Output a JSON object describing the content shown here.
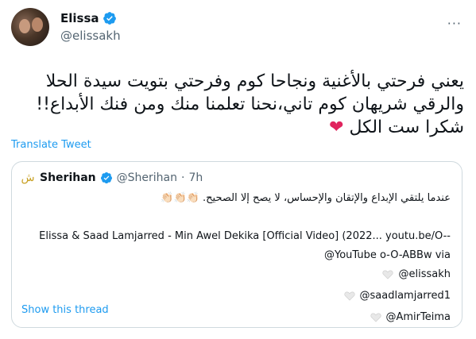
{
  "author": {
    "name": "Elissa",
    "handle": "@elissakh",
    "verified": true
  },
  "more_label": "···",
  "tweet": {
    "line1": "يعني فرحتي بالأغنية ونجاحا كوم وفرحتي بتويت سيدة الحلا",
    "line2": "والرقي شريهان كوم تاني،نحنا تعلمنا منك ومن فنك الأبداع!!",
    "line3": "شكرا ست الكل",
    "heart": "❤"
  },
  "translate_label": "Translate Tweet",
  "quote": {
    "avatar_glyph": "ش",
    "name": "Sherihan",
    "handle": "@Sherihan",
    "separator": "·",
    "time": "7h",
    "line1": "عندما يلتقي الإبداع والإتقان والإحساس، لا يصح إلا الصحيح. 👏🏻👏🏻👏🏻",
    "line2": "Elissa & Saad Lamjarred - Min Awel Dekika [Official Video] (2022... youtu.be/O--",
    "line3": "@YouTube o-O-ABBw via",
    "mentions": [
      "@elissakh",
      "@saadlamjarred1",
      "@AmirTeima"
    ],
    "show_thread": "Show this thread"
  },
  "colors": {
    "accent": "#1d9bf0",
    "heart": "#e0245e",
    "muted": "#536471",
    "border": "#cfd9de"
  }
}
